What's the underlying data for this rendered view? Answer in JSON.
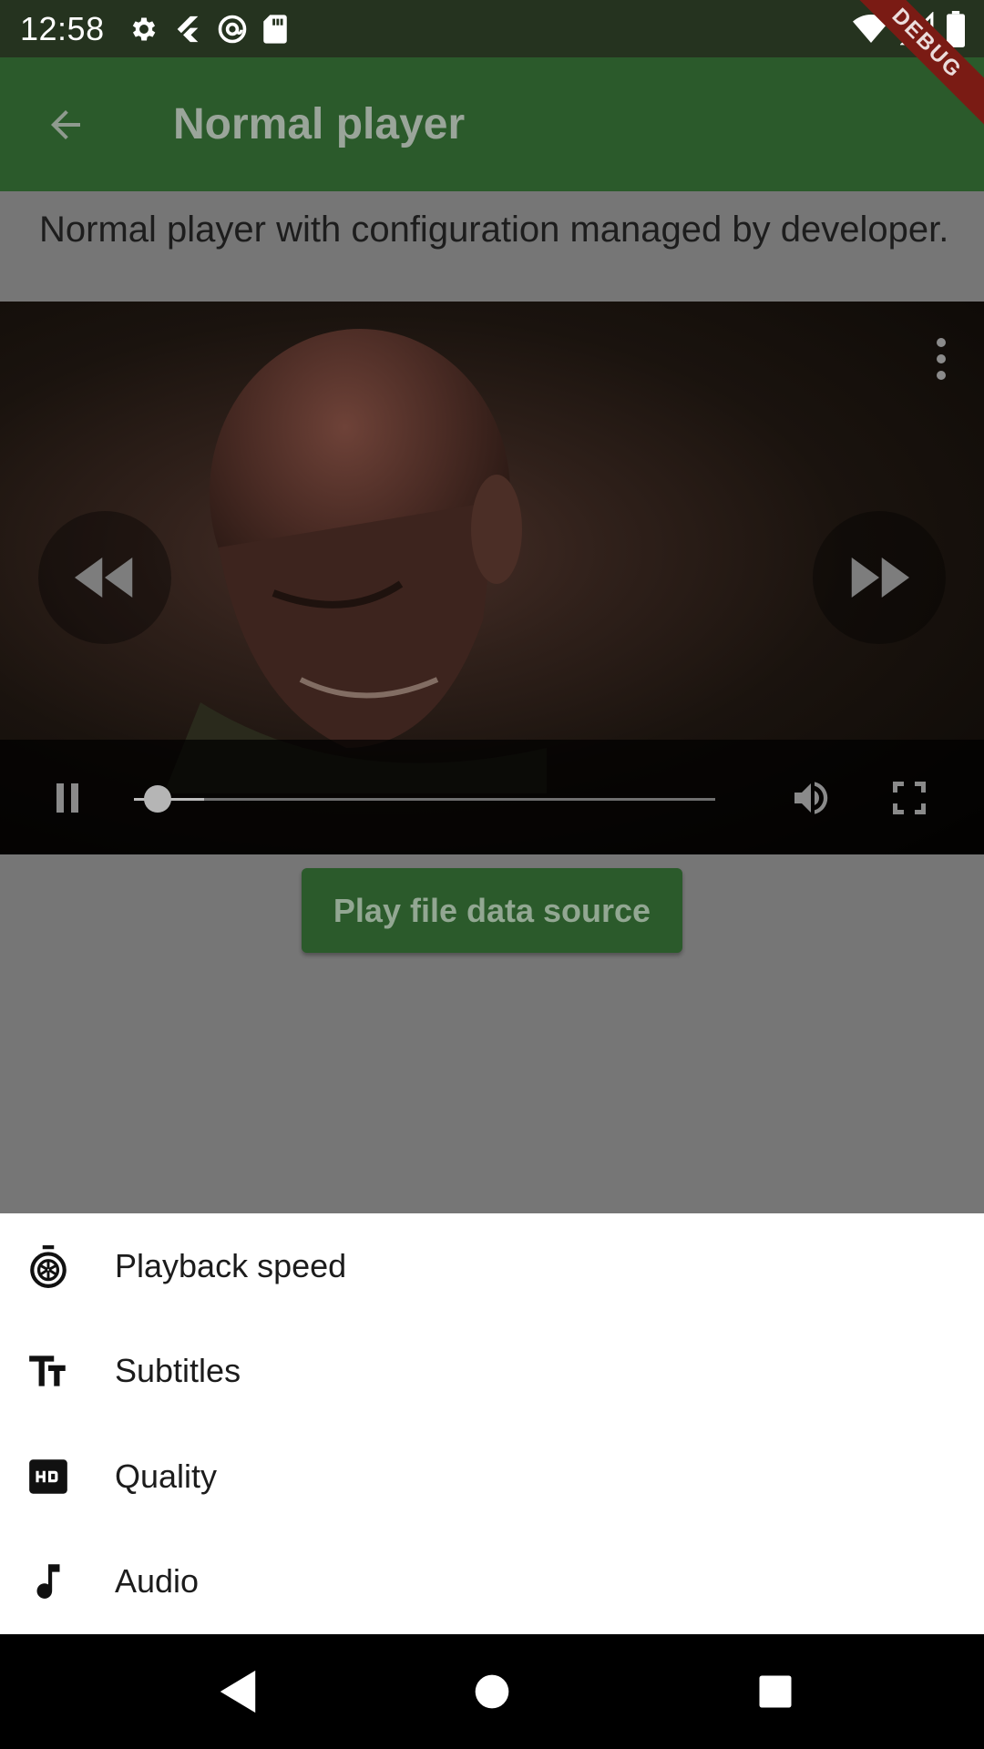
{
  "status_bar": {
    "time": "12:58",
    "left_icons": [
      "settings-icon",
      "flutter-icon",
      "at-sign-icon",
      "sd-card-icon"
    ],
    "right_icons": [
      "wifi-icon",
      "signal-icon",
      "battery-icon"
    ]
  },
  "debug_banner": "DEBUG",
  "app_bar": {
    "title": "Normal player",
    "back_icon": "arrow-back-icon"
  },
  "description": "Normal player with configuration managed by developer.",
  "player": {
    "progress": 0.04,
    "buffered": 0.12,
    "controls": [
      "pause-icon",
      "volume-icon",
      "fullscreen-icon"
    ],
    "seek_buttons": [
      "rewind-icon",
      "fast-forward-icon"
    ]
  },
  "play_file_button": "Play file data source",
  "bottom_sheet": {
    "items": [
      {
        "label": "Playback speed",
        "icon": "speed-icon"
      },
      {
        "label": "Subtitles",
        "icon": "text-fields-icon"
      },
      {
        "label": "Quality",
        "icon": "hd-icon"
      },
      {
        "label": "Audio",
        "icon": "music-note-icon"
      }
    ]
  },
  "nav_bar": [
    "back-icon",
    "home-icon",
    "recents-icon"
  ],
  "colors": {
    "app_bar": "#2b5a2b",
    "status_bar": "#25331f",
    "scrim": "#767676",
    "sheet": "#ffffff"
  }
}
